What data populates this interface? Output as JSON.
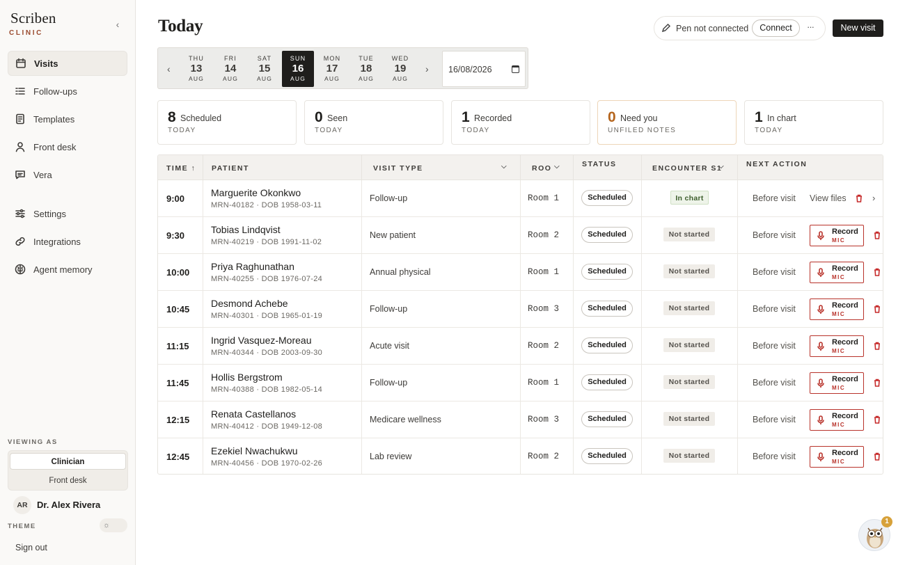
{
  "brand": {
    "name": "Scriben",
    "sub": "CLINIC"
  },
  "sidebar": {
    "items": [
      {
        "label": "Visits",
        "icon": "calendar-icon",
        "active": true
      },
      {
        "label": "Follow-ups",
        "icon": "list-check-icon"
      },
      {
        "label": "Templates",
        "icon": "document-icon"
      },
      {
        "label": "Front desk",
        "icon": "person-icon"
      },
      {
        "label": "Vera",
        "icon": "chat-icon"
      },
      {
        "label": "Settings",
        "icon": "sliders-icon"
      },
      {
        "label": "Integrations",
        "icon": "link-icon"
      },
      {
        "label": "Agent memory",
        "icon": "brain-icon"
      }
    ],
    "viewing_as_label": "VIEWING AS",
    "roles": [
      "Clinician",
      "Front desk"
    ],
    "user_initials": "AR",
    "user_name": "Dr. Alex Rivera",
    "theme_label": "THEME",
    "sign_out": "Sign out"
  },
  "header": {
    "title": "Today",
    "pen_status": "Pen not connected",
    "connect_label": "Connect",
    "more_label": "···",
    "new_visit_label": "New visit"
  },
  "date_strip": {
    "prev": "‹",
    "next": "›",
    "days": [
      {
        "dow": "THU",
        "dom": "13",
        "mon": "AUG"
      },
      {
        "dow": "FRI",
        "dom": "14",
        "mon": "AUG"
      },
      {
        "dow": "SAT",
        "dom": "15",
        "mon": "AUG"
      },
      {
        "dow": "SUN",
        "dom": "16",
        "mon": "AUG",
        "selected": true
      },
      {
        "dow": "MON",
        "dom": "17",
        "mon": "AUG"
      },
      {
        "dow": "TUE",
        "dom": "18",
        "mon": "AUG"
      },
      {
        "dow": "WED",
        "dom": "19",
        "mon": "AUG"
      }
    ],
    "date_value": "16/08/2026"
  },
  "stats": [
    {
      "num": "8",
      "label": "Scheduled",
      "sub": "TODAY"
    },
    {
      "num": "0",
      "label": "Seen",
      "sub": "TODAY"
    },
    {
      "num": "1",
      "label": "Recorded",
      "sub": "TODAY"
    },
    {
      "num": "0",
      "label": "Need you",
      "sub": "UNFILED NOTES",
      "highlight": true
    },
    {
      "num": "1",
      "label": "In chart",
      "sub": "TODAY"
    }
  ],
  "table": {
    "headers": {
      "time": "TIME ↑",
      "patient": "PATIENT",
      "visit_type": "VISIT TYPE",
      "room": "ROO",
      "status": "STATUS",
      "encounter": "ENCOUNTER S1",
      "next_action": "NEXT ACTION"
    },
    "rows": [
      {
        "time": "9:00",
        "name": "Marguerite Okonkwo",
        "meta": "MRN-40182 · DOB 1958-03-11",
        "visit_type": "Follow-up",
        "room": "Room 1",
        "status": "Scheduled",
        "encounter": "In chart",
        "action": "Before visit",
        "secondary": "View files"
      },
      {
        "time": "9:30",
        "name": "Tobias Lindqvist",
        "meta": "MRN-40219 · DOB 1991-11-02",
        "visit_type": "New patient",
        "room": "Room 2",
        "status": "Scheduled",
        "encounter": "Not started",
        "action": "Before visit",
        "record": "Record",
        "record_sub": "MIC"
      },
      {
        "time": "10:00",
        "name": "Priya Raghunathan",
        "meta": "MRN-40255 · DOB 1976-07-24",
        "visit_type": "Annual physical",
        "room": "Room 1",
        "status": "Scheduled",
        "encounter": "Not started",
        "action": "Before visit",
        "record": "Record",
        "record_sub": "MIC"
      },
      {
        "time": "10:45",
        "name": "Desmond Achebe",
        "meta": "MRN-40301 · DOB 1965-01-19",
        "visit_type": "Follow-up",
        "room": "Room 3",
        "status": "Scheduled",
        "encounter": "Not started",
        "action": "Before visit",
        "record": "Record",
        "record_sub": "MIC"
      },
      {
        "time": "11:15",
        "name": "Ingrid Vasquez-Moreau",
        "meta": "MRN-40344 · DOB 2003-09-30",
        "visit_type": "Acute visit",
        "room": "Room 2",
        "status": "Scheduled",
        "encounter": "Not started",
        "action": "Before visit",
        "record": "Record",
        "record_sub": "MIC"
      },
      {
        "time": "11:45",
        "name": "Hollis Bergstrom",
        "meta": "MRN-40388 · DOB 1982-05-14",
        "visit_type": "Follow-up",
        "room": "Room 1",
        "status": "Scheduled",
        "encounter": "Not started",
        "action": "Before visit",
        "record": "Record",
        "record_sub": "MIC"
      },
      {
        "time": "12:15",
        "name": "Renata Castellanos",
        "meta": "MRN-40412 · DOB 1949-12-08",
        "visit_type": "Medicare wellness",
        "room": "Room 3",
        "status": "Scheduled",
        "encounter": "Not started",
        "action": "Before visit",
        "record": "Record",
        "record_sub": "MIC"
      },
      {
        "time": "12:45",
        "name": "Ezekiel Nwachukwu",
        "meta": "MRN-40456 · DOB 1970-02-26",
        "visit_type": "Lab review",
        "room": "Room 2",
        "status": "Scheduled",
        "encounter": "Not started",
        "action": "Before visit",
        "record": "Record",
        "record_sub": "MIC"
      }
    ]
  },
  "helper": {
    "badge": "1",
    "icon": "owl-assistant-icon"
  },
  "colors": {
    "accent": "#9a4a2e",
    "record": "#b8322a",
    "highlight": "#b5651d",
    "dark": "#1f1e1c"
  }
}
